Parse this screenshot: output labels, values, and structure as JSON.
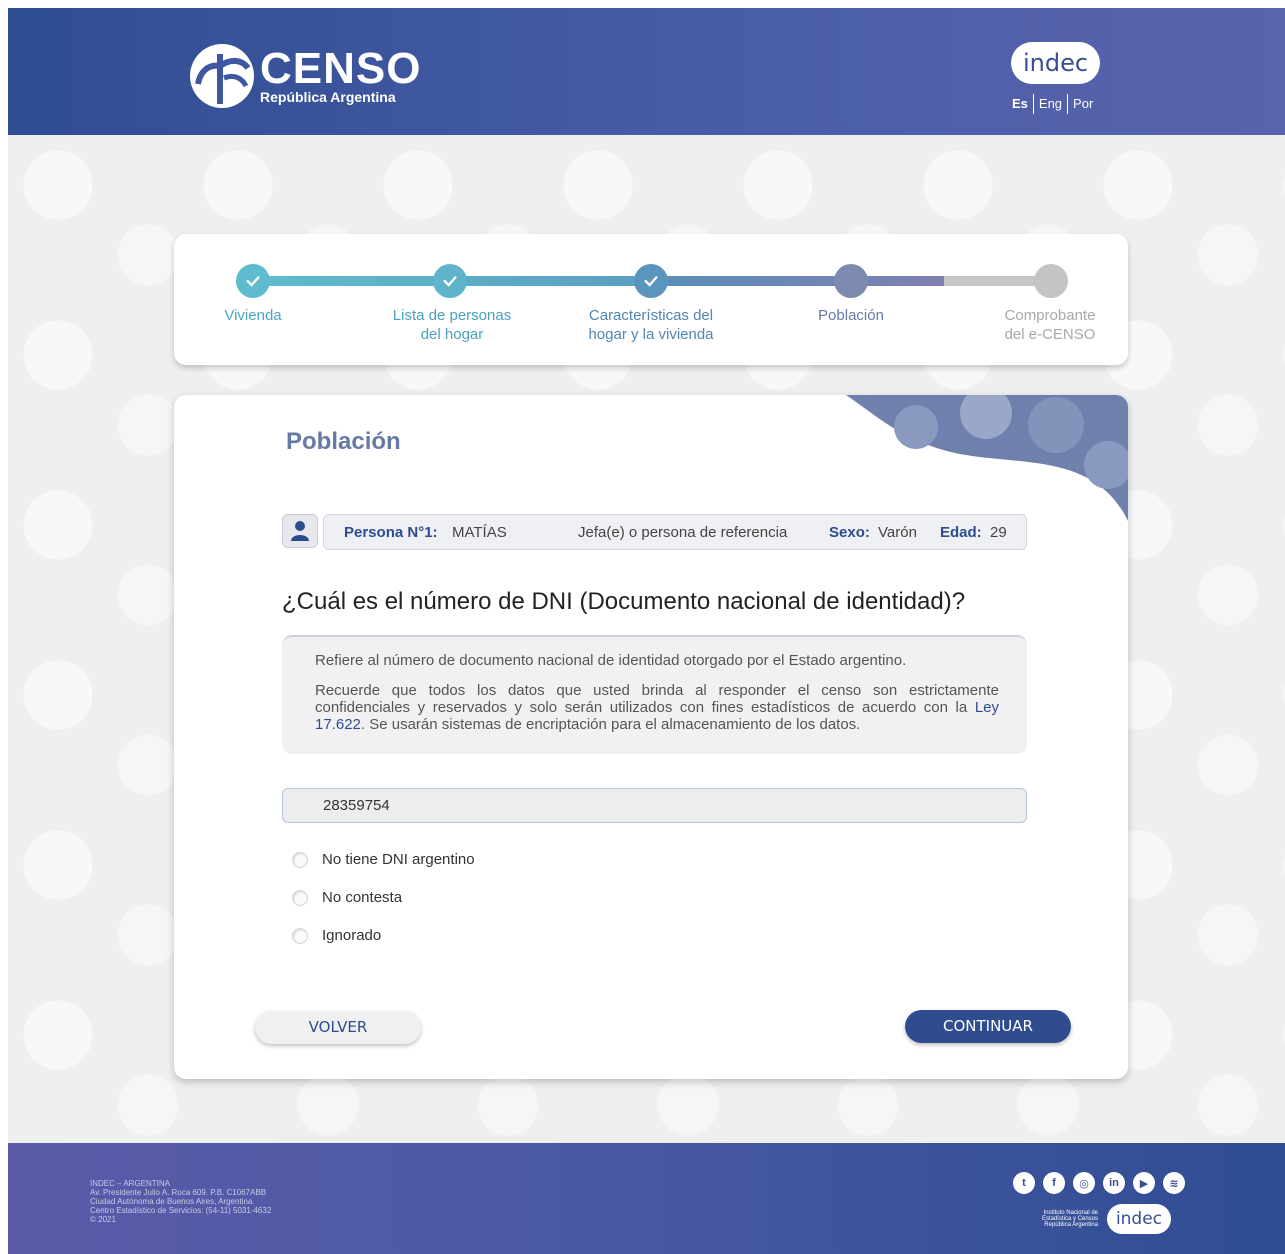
{
  "header": {
    "logo_title": "CENSO",
    "logo_subtitle": "República Argentina",
    "indec_label": "indec",
    "languages": [
      "Es",
      "Eng",
      "Por"
    ]
  },
  "stepper": {
    "steps": [
      {
        "label_line1": "Vivienda",
        "label_line2": "",
        "state": "done"
      },
      {
        "label_line1": "Lista de personas",
        "label_line2": "del hogar",
        "state": "done"
      },
      {
        "label_line1": "Características del",
        "label_line2": "hogar y la vivienda",
        "state": "done"
      },
      {
        "label_line1": "Población",
        "label_line2": "",
        "state": "current"
      },
      {
        "label_line1": "Comprobante",
        "label_line2": "del e-CENSO",
        "state": "pending"
      }
    ]
  },
  "main": {
    "section_title": "Población",
    "person": {
      "number_label": "Persona N°1:",
      "name": "MATÍAS",
      "role": "Jefa(e) o persona de referencia",
      "sex_label": "Sexo:",
      "sex": "Varón",
      "age_label": "Edad:",
      "age": "29"
    },
    "question": "¿Cuál es el número de DNI (Documento nacional de identidad)?",
    "info": {
      "line1": "Refiere al número de documento nacional de identidad otorgado por el Estado argentino.",
      "line2_a": "Recuerde que todos los datos que usted brinda al responder el censo son estrictamente confidenciales y reservados y solo serán utilizados con fines estadísticos de acuerdo con la ",
      "law_link": "Ley 17.622",
      "line2_b": ". Se usarán sistemas de encriptación para el almacenamiento de los datos."
    },
    "dni_value": "28359754",
    "options": [
      "No tiene DNI argentino",
      "No contesta",
      "Ignorado"
    ],
    "back_label": "VOLVER",
    "continue_label": "CONTINUAR"
  },
  "footer": {
    "lines": [
      "INDEC – ARGENTINA",
      "Av. Presidente Julio A. Roca 609. P.B. C1067ABB",
      "Ciudad Autónoma de Buenos Aires, Argentina.",
      "Centro Estadístico de Servicios: (54-11) 5031-4632",
      "© 2021"
    ],
    "social_icons": [
      "twitter-icon",
      "facebook-icon",
      "instagram-icon",
      "linkedin-icon",
      "youtube-icon",
      "spotify-icon"
    ],
    "institute": [
      "Instituto Nacional de",
      "Estadística y Censos",
      "República Argentina"
    ],
    "indec_label": "indec"
  },
  "colors": {
    "brand_blue": "#2f4d8e",
    "step_done": "#5ab3c8",
    "step_current": "#7d8bb0",
    "step_pending": "#c4c4c4"
  }
}
